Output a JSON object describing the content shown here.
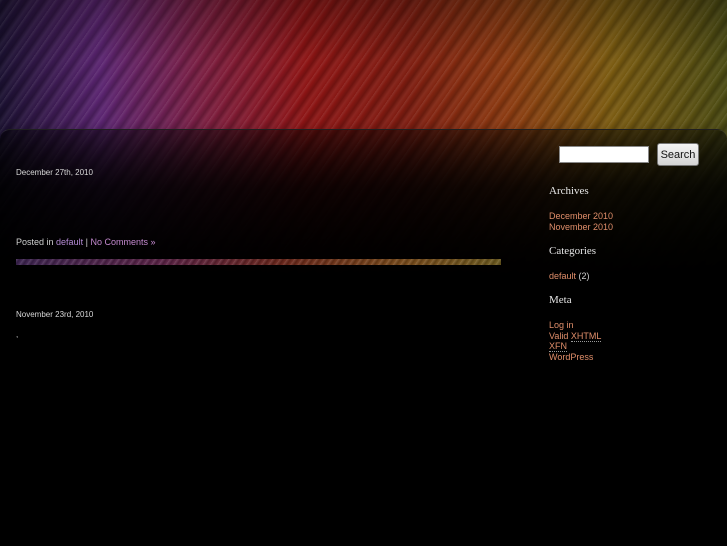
{
  "posts": [
    {
      "date": "December 27th, 2010",
      "meta_prefix": "Posted in",
      "category": "default",
      "separator": "|",
      "comments": "No Comments »"
    },
    {
      "date": "November 23rd, 2010",
      "excerpt": ","
    }
  ],
  "sidebar": {
    "search_button": "Search",
    "archives": {
      "title": "Archives",
      "items": [
        "December 2010",
        "November 2010"
      ]
    },
    "categories": {
      "title": "Categories",
      "items": [
        {
          "label": "default",
          "count": "(2)"
        }
      ]
    },
    "meta": {
      "title": "Meta",
      "items": [
        "Log in",
        "Valid",
        "XHTML",
        "XFN",
        "WordPress"
      ]
    }
  },
  "colors": {
    "link_purple": "#b58bd6",
    "link_orange": "#e08e6a",
    "background": "#000000"
  }
}
